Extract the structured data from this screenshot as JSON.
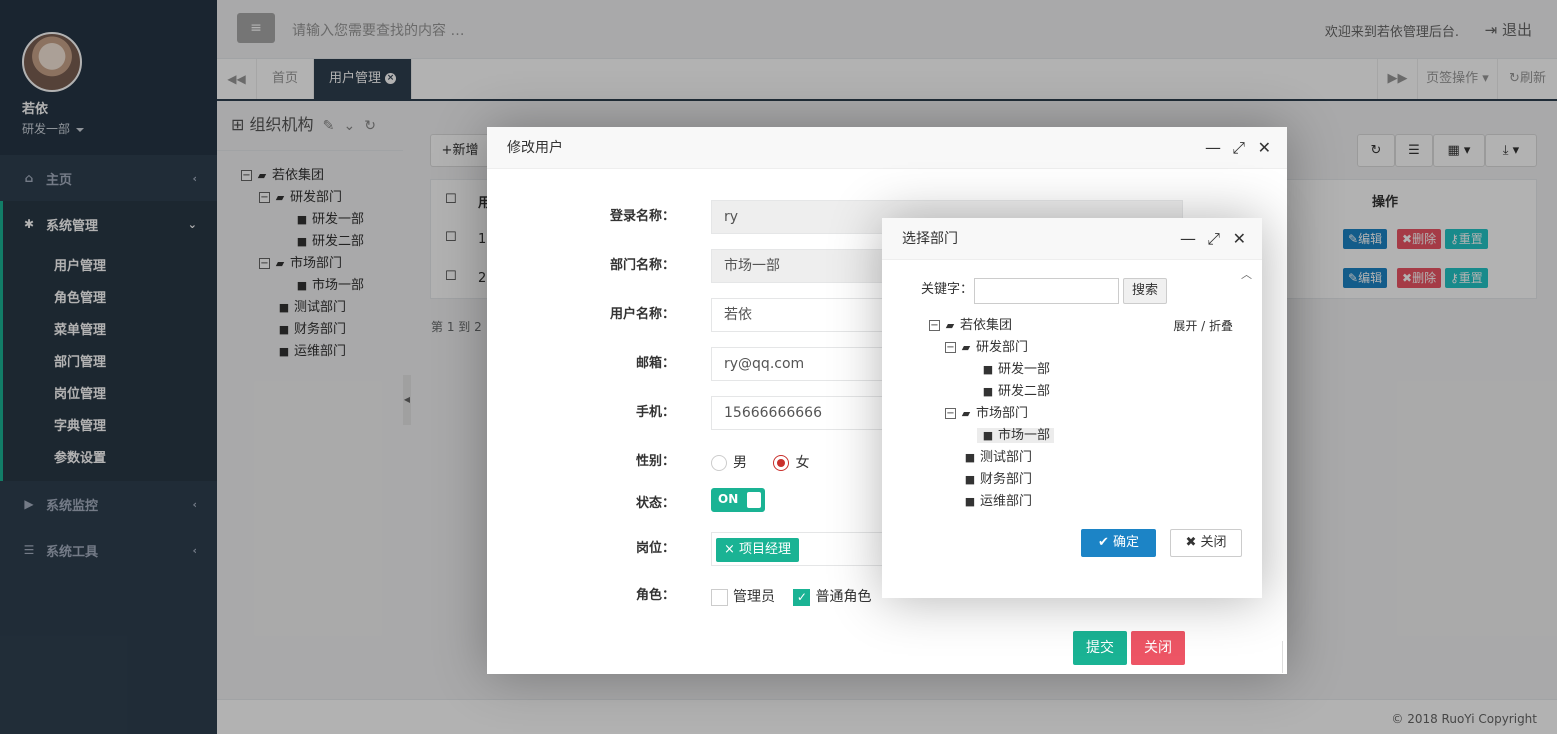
{
  "profile": {
    "name": "若依",
    "dept": "研发一部"
  },
  "sidebar": {
    "items": [
      {
        "label": "主页",
        "icon": "home-icon"
      },
      {
        "label": "系统管理",
        "icon": "gear-icon"
      },
      {
        "label": "系统监控",
        "icon": "video-icon"
      },
      {
        "label": "系统工具",
        "icon": "bars-icon"
      }
    ],
    "sub_items": [
      "用户管理",
      "角色管理",
      "菜单管理",
      "部门管理",
      "岗位管理",
      "字典管理",
      "参数设置"
    ]
  },
  "topbar": {
    "search_placeholder": "请输入您需要查找的内容 …",
    "welcome": "欢迎来到若依管理后台.",
    "logout": "退出"
  },
  "tabs": {
    "home": "首页",
    "active": "用户管理",
    "page_ops": "页签操作",
    "refresh": "刷新"
  },
  "org": {
    "title": "组织机构",
    "tree": [
      "若依集团",
      "研发部门",
      "研发一部",
      "研发二部",
      "市场部门",
      "市场一部",
      "测试部门",
      "财务部门",
      "运维部门"
    ]
  },
  "main": {
    "add_btn": "新增",
    "col_prefix": "用",
    "row1_num": "1",
    "row2_num": "2",
    "col_ops": "操作",
    "pager": "第 1 到 2",
    "btn_edit": "编辑",
    "btn_delete": "删除",
    "btn_reset": "重置"
  },
  "edit_modal": {
    "title": "修改用户",
    "login_label": "登录名称：",
    "login_value": "ry",
    "dept_label": "部门名称：",
    "dept_value": "市场一部",
    "username_label": "用户名称：",
    "username_value": "若依",
    "email_label": "邮箱：",
    "email_value": "ry@qq.com",
    "phone_label": "手机：",
    "phone_value": "15666666666",
    "gender_label": "性别：",
    "gender_male": "男",
    "gender_female": "女",
    "status_label": "状态：",
    "status_value": "ON",
    "post_label": "岗位：",
    "post_value": "项目经理",
    "role_label": "角色：",
    "role_admin": "管理员",
    "role_common": "普通角色",
    "submit": "提交",
    "close": "关闭"
  },
  "dept_modal": {
    "title": "选择部门",
    "keyword_label": "关键字：",
    "search_btn": "搜索",
    "expand_collapse": "展开 / 折叠",
    "tree": [
      "若依集团",
      "研发部门",
      "研发一部",
      "研发二部",
      "市场部门",
      "市场一部",
      "测试部门",
      "财务部门",
      "运维部门"
    ],
    "ok": "确定",
    "close": "关闭"
  },
  "footer": {
    "copyright": "© 2018 RuoYi Copyright"
  },
  "colors": {
    "sidebar": "#2f4050",
    "accent": "#1ab394",
    "primary": "#1c84c6",
    "danger": "#ed5565"
  }
}
